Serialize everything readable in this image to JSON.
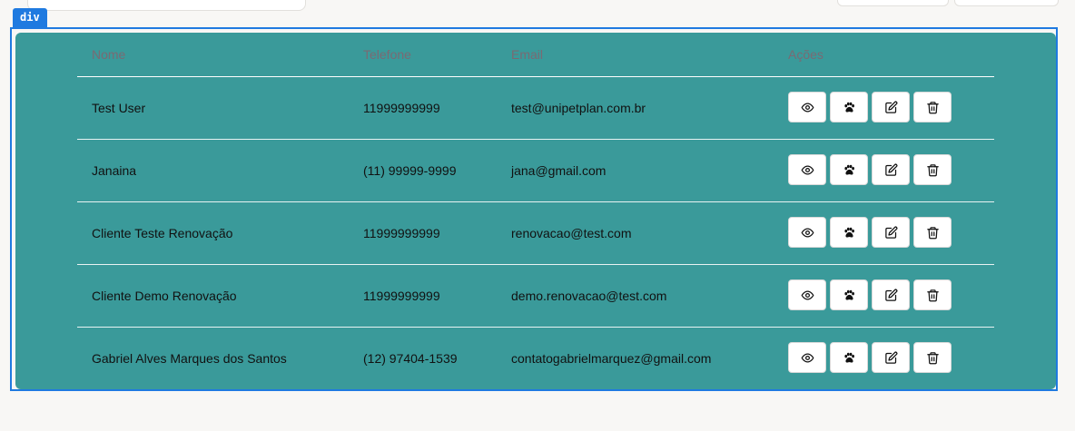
{
  "inspector": {
    "tag": "div"
  },
  "table": {
    "headers": {
      "name": "Nome",
      "phone": "Telefone",
      "email": "Email",
      "actions": "Ações"
    },
    "rows": [
      {
        "name": "Test User",
        "phone": "11999999999",
        "email": "test@unipetplan.com.br"
      },
      {
        "name": "Janaina",
        "phone": "(11) 99999-9999",
        "email": "jana@gmail.com"
      },
      {
        "name": "Cliente Teste Renovação",
        "phone": "11999999999",
        "email": "renovacao@test.com"
      },
      {
        "name": "Cliente Demo Renovação",
        "phone": "11999999999",
        "email": "demo.renovacao@test.com"
      },
      {
        "name": "Gabriel Alves Marques dos Santos",
        "phone": "(12) 97404-1539",
        "email": "contatogabrielmarquez@gmail.com"
      }
    ],
    "row_actions": [
      {
        "icon": "eye-icon"
      },
      {
        "icon": "paw-icon"
      },
      {
        "icon": "edit-icon"
      },
      {
        "icon": "trash-icon"
      }
    ]
  },
  "colors": {
    "card_background": "#3a9a9a",
    "header_text": "#7a6a73",
    "inspector_accent": "#1f7ae0"
  }
}
